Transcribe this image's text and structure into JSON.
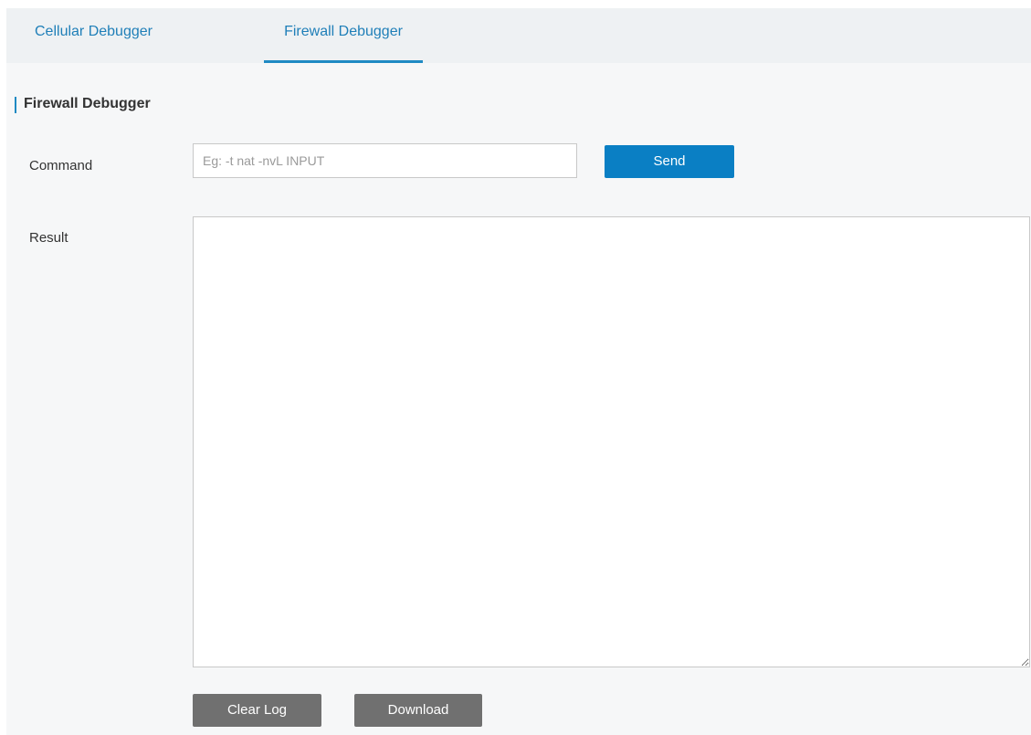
{
  "tabs": [
    {
      "label": "Cellular Debugger",
      "active": false
    },
    {
      "label": "Firewall Debugger",
      "active": true
    }
  ],
  "section": {
    "title": "Firewall Debugger"
  },
  "form": {
    "command_label": "Command",
    "command_placeholder": "Eg: -t nat -nvL INPUT",
    "command_value": "",
    "send_label": "Send",
    "result_label": "Result",
    "result_value": ""
  },
  "actions": {
    "clear_log_label": "Clear Log",
    "download_label": "Download"
  },
  "colors": {
    "accent": "#1f8ac3",
    "send_button": "#0a7fc4",
    "secondary_button": "#707070",
    "tab_bar": "#eef1f3",
    "panel": "#f6f7f8"
  },
  "icons": [
    "resize-handle-icon"
  ]
}
